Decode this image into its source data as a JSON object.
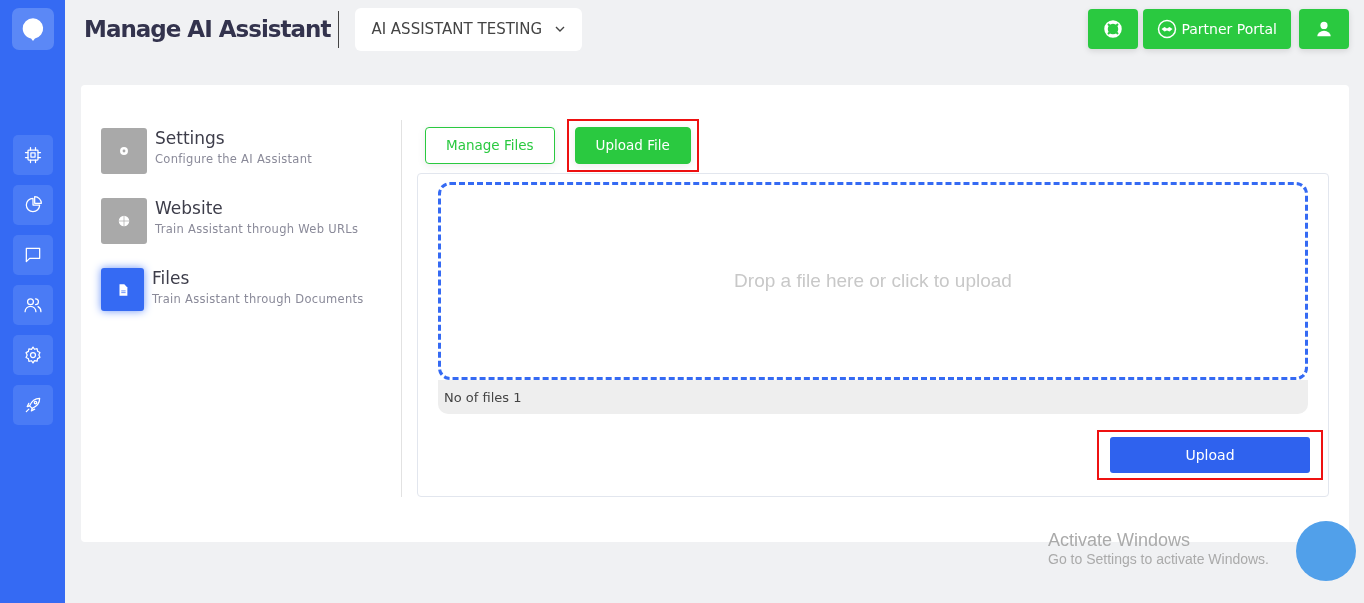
{
  "header": {
    "title": "Manage AI Assistant",
    "assistant_dropdown": "AI ASSISTANT TESTING",
    "partner_button": "Partner Portal"
  },
  "nav": [
    {
      "kind": "chip",
      "selected": false
    },
    {
      "kind": "chart",
      "selected": false
    },
    {
      "kind": "chat",
      "selected": false
    },
    {
      "kind": "users",
      "selected": false
    },
    {
      "kind": "gear",
      "selected": false
    },
    {
      "kind": "rocket",
      "selected": false
    }
  ],
  "menu": [
    {
      "kind": "gear",
      "title": "Settings",
      "subtitle": "Configure the AI Assistant",
      "selected": false
    },
    {
      "kind": "globe",
      "title": "Website",
      "subtitle": "Train Assistant through Web URLs",
      "selected": false
    },
    {
      "kind": "file",
      "title": "Files",
      "subtitle": "Train Assistant through Documents",
      "selected": true
    }
  ],
  "tabs": [
    {
      "label": "Manage Files",
      "selected": false,
      "highlighted": false
    },
    {
      "label": "Upload File",
      "selected": true,
      "highlighted": true
    }
  ],
  "dropzone": {
    "text": "Drop a file here or click to upload",
    "file_count": "No of files 1"
  },
  "upload_button": {
    "label": "Upload",
    "highlighted": true
  },
  "os_notice": {
    "title": "Activate Windows",
    "text": "Go to Settings to activate Windows."
  }
}
